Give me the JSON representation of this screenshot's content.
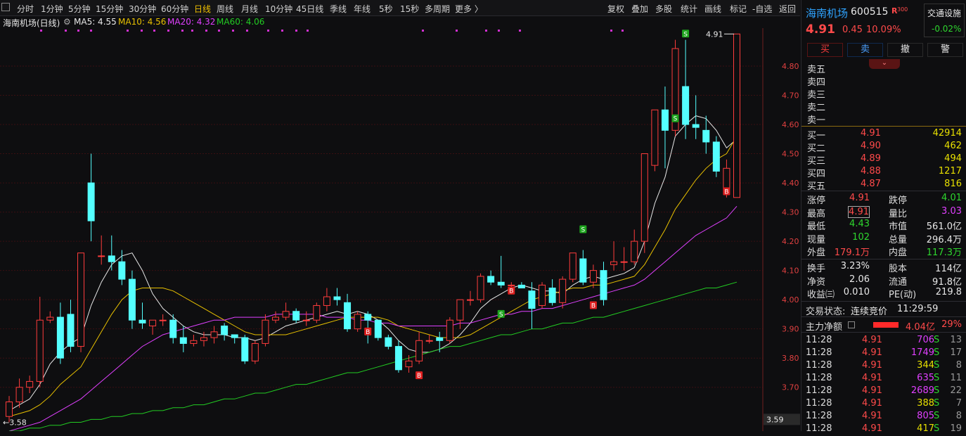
{
  "toolbar": {
    "periods": [
      "分时",
      "1分钟",
      "5分钟",
      "15分钟",
      "30分钟",
      "60分钟",
      "日线",
      "周线",
      "月线",
      "10分钟",
      "45日线",
      "季线",
      "年线",
      "5秒",
      "15秒",
      "多周期",
      "更多 〉"
    ],
    "active_period": "日线",
    "tools": [
      "复权",
      "叠加",
      "多股",
      "统计",
      "画线",
      "标记",
      "-自选",
      "返回"
    ]
  },
  "chart_title": "海南机场(日线)",
  "ma_legend": [
    {
      "label": "MA5: 4.55",
      "color": "#e8e8e8"
    },
    {
      "label": "MA10: 4.56",
      "color": "#e8c000"
    },
    {
      "label": "MA20: 4.32",
      "color": "#e040ff"
    },
    {
      "label": "MA60: 4.06",
      "color": "#22cc22"
    }
  ],
  "chart_data": {
    "type": "candlestick",
    "ylim": [
      3.55,
      4.93
    ],
    "yticks": [
      "4.80",
      "4.70",
      "4.60",
      "4.50",
      "4.40",
      "4.30",
      "4.20",
      "4.10",
      "4.00",
      "3.90",
      "3.80",
      "3.70"
    ],
    "ytick_values": [
      4.8,
      4.7,
      4.6,
      4.5,
      4.4,
      4.3,
      4.2,
      4.1,
      4.0,
      3.9,
      3.8,
      3.7
    ],
    "cursor_value": "3.59",
    "high_label": "4.91",
    "low_label": "3.58",
    "candles": [
      [
        3.6,
        3.65,
        3.58,
        3.67
      ],
      [
        3.65,
        3.7,
        3.63,
        3.73
      ],
      [
        3.7,
        3.72,
        3.68,
        3.74
      ],
      [
        3.72,
        3.93,
        3.7,
        4.01
      ],
      [
        3.93,
        3.94,
        3.92,
        3.96
      ],
      [
        3.94,
        3.8,
        3.78,
        3.99
      ],
      [
        3.95,
        3.84,
        3.82,
        4.0
      ],
      [
        3.84,
        4.16,
        3.82,
        4.16
      ],
      [
        4.4,
        4.27,
        4.2,
        4.5
      ],
      [
        4.15,
        4.15,
        4.12,
        4.22
      ],
      [
        4.15,
        4.13,
        4.1,
        4.22
      ],
      [
        4.13,
        4.07,
        4.05,
        4.17
      ],
      [
        4.07,
        3.93,
        3.9,
        4.1
      ],
      [
        3.93,
        3.92,
        3.9,
        3.99
      ],
      [
        3.91,
        3.93,
        3.88,
        3.93
      ],
      [
        3.93,
        3.93,
        3.91,
        3.95
      ],
      [
        3.93,
        3.87,
        3.85,
        3.95
      ],
      [
        3.87,
        3.85,
        3.82,
        3.91
      ],
      [
        3.85,
        3.86,
        3.84,
        3.88
      ],
      [
        3.86,
        3.87,
        3.84,
        3.89
      ],
      [
        3.87,
        3.89,
        3.85,
        3.91
      ],
      [
        3.91,
        3.88,
        3.86,
        3.92
      ],
      [
        3.88,
        3.87,
        3.85,
        3.88
      ],
      [
        3.87,
        3.79,
        3.78,
        3.88
      ],
      [
        3.79,
        3.85,
        3.78,
        3.86
      ],
      [
        3.85,
        3.93,
        3.84,
        3.95
      ],
      [
        3.93,
        3.94,
        3.92,
        3.96
      ],
      [
        3.94,
        3.96,
        3.93,
        3.99
      ],
      [
        3.96,
        3.93,
        3.92,
        3.97
      ],
      [
        3.93,
        3.93,
        3.91,
        3.96
      ],
      [
        3.93,
        3.98,
        3.92,
        3.99
      ],
      [
        3.98,
        4.01,
        3.96,
        4.04
      ],
      [
        4.01,
        4.0,
        3.98,
        4.04
      ],
      [
        3.99,
        3.9,
        3.89,
        4.02
      ],
      [
        3.9,
        3.95,
        3.89,
        3.96
      ],
      [
        3.95,
        3.93,
        3.85,
        3.96
      ],
      [
        3.93,
        3.87,
        3.86,
        3.93
      ],
      [
        3.87,
        3.84,
        3.83,
        3.88
      ],
      [
        3.84,
        3.76,
        3.75,
        3.86
      ],
      [
        3.77,
        3.79,
        3.75,
        3.81
      ],
      [
        3.79,
        3.86,
        3.78,
        3.89
      ],
      [
        3.86,
        3.86,
        3.85,
        3.88
      ],
      [
        3.87,
        3.86,
        3.82,
        3.89
      ],
      [
        3.86,
        3.93,
        3.85,
        3.94
      ],
      [
        3.93,
        4.0,
        3.9,
        4.0
      ],
      [
        4.0,
        4.0,
        3.98,
        4.03
      ],
      [
        4.0,
        4.08,
        3.99,
        4.09
      ],
      [
        4.08,
        4.06,
        4.05,
        4.1
      ],
      [
        4.06,
        4.05,
        4.04,
        4.15
      ],
      [
        4.05,
        4.05,
        4.03,
        4.06
      ],
      [
        4.05,
        4.04,
        4.04,
        4.06
      ],
      [
        4.03,
        3.97,
        3.9,
        4.06
      ],
      [
        3.98,
        4.05,
        3.97,
        4.06
      ],
      [
        4.04,
        3.99,
        3.98,
        4.07
      ],
      [
        3.99,
        4.07,
        3.97,
        4.08
      ],
      [
        4.07,
        4.16,
        4.06,
        4.16
      ],
      [
        4.14,
        4.06,
        4.05,
        4.17
      ],
      [
        4.06,
        4.1,
        4.04,
        4.12
      ],
      [
        4.1,
        4.0,
        3.98,
        4.13
      ],
      [
        4.12,
        4.13,
        4.1,
        4.2
      ],
      [
        4.13,
        4.13,
        4.1,
        4.18
      ],
      [
        4.13,
        4.2,
        4.12,
        4.24
      ],
      [
        4.2,
        4.5,
        4.16,
        4.5
      ],
      [
        4.46,
        4.65,
        4.44,
        4.64
      ],
      [
        4.65,
        4.58,
        4.45,
        4.73
      ],
      [
        4.58,
        4.86,
        4.56,
        4.89
      ],
      [
        4.73,
        4.6,
        4.55,
        4.89
      ],
      [
        4.6,
        4.59,
        4.55,
        4.7
      ],
      [
        4.58,
        4.54,
        4.5,
        4.63
      ],
      [
        4.54,
        4.44,
        4.42,
        4.56
      ],
      [
        4.38,
        4.45,
        4.35,
        4.48
      ],
      [
        4.35,
        4.91,
        4.43,
        4.91
      ]
    ],
    "markers": [
      {
        "label": "S",
        "index": 56,
        "value": 4.24,
        "color": "#1ea51e"
      },
      {
        "label": "B",
        "index": 35,
        "value": 3.89,
        "color": "#e02020"
      },
      {
        "label": "S",
        "index": 48,
        "value": 3.95,
        "color": "#1ea51e"
      },
      {
        "label": "B",
        "index": 40,
        "value": 3.74,
        "color": "#e02020"
      },
      {
        "label": "B",
        "index": 49,
        "value": 4.03,
        "color": "#e02020"
      },
      {
        "label": "B",
        "index": 57,
        "value": 3.98,
        "color": "#e02020"
      },
      {
        "label": "S",
        "index": 65,
        "value": 4.62,
        "color": "#1ea51e"
      },
      {
        "label": "S",
        "index": 66,
        "value": 4.91,
        "color": "#1ea51e"
      },
      {
        "label": "B",
        "index": 70,
        "value": 4.37,
        "color": "#e02020"
      }
    ],
    "series": [
      {
        "name": "MA5",
        "color": "#e8e8e8",
        "values": [
          3.62,
          3.64,
          3.66,
          3.71,
          3.78,
          3.82,
          3.85,
          3.87,
          3.98,
          4.06,
          4.12,
          4.15,
          4.16,
          4.1,
          4.02,
          3.97,
          3.94,
          3.91,
          3.89,
          3.88,
          3.88,
          3.88,
          3.87,
          3.87,
          3.86,
          3.87,
          3.89,
          3.91,
          3.92,
          3.93,
          3.94,
          3.95,
          3.96,
          3.95,
          3.96,
          3.95,
          3.93,
          3.9,
          3.86,
          3.83,
          3.82,
          3.82,
          3.83,
          3.85,
          3.88,
          3.92,
          3.97,
          4.0,
          4.02,
          4.04,
          4.05,
          4.04,
          4.03,
          4.03,
          4.02,
          4.05,
          4.07,
          4.08,
          4.07,
          4.08,
          4.09,
          4.11,
          4.2,
          4.33,
          4.42,
          4.56,
          4.6,
          4.63,
          4.62,
          4.58,
          4.52,
          4.55
        ]
      },
      {
        "name": "MA10",
        "color": "#e8c000",
        "values": [
          3.6,
          3.61,
          3.62,
          3.64,
          3.67,
          3.71,
          3.74,
          3.77,
          3.83,
          3.89,
          3.95,
          4.0,
          4.03,
          4.04,
          4.04,
          4.04,
          4.03,
          4.01,
          3.99,
          3.97,
          3.95,
          3.93,
          3.91,
          3.89,
          3.88,
          3.88,
          3.88,
          3.88,
          3.89,
          3.9,
          3.91,
          3.92,
          3.93,
          3.94,
          3.94,
          3.94,
          3.94,
          3.93,
          3.91,
          3.9,
          3.89,
          3.88,
          3.87,
          3.87,
          3.87,
          3.88,
          3.9,
          3.92,
          3.94,
          3.96,
          3.98,
          4.0,
          4.01,
          4.02,
          4.03,
          4.04,
          4.04,
          4.05,
          4.05,
          4.06,
          4.07,
          4.08,
          4.12,
          4.18,
          4.24,
          4.31,
          4.36,
          4.41,
          4.45,
          4.48,
          4.5,
          4.56
        ]
      },
      {
        "name": "MA20",
        "color": "#e040ff",
        "values": [
          3.55,
          3.56,
          3.57,
          3.58,
          3.6,
          3.62,
          3.64,
          3.66,
          3.69,
          3.72,
          3.75,
          3.78,
          3.81,
          3.84,
          3.86,
          3.88,
          3.89,
          3.9,
          3.91,
          3.92,
          3.93,
          3.93,
          3.94,
          3.94,
          3.94,
          3.94,
          3.95,
          3.95,
          3.95,
          3.95,
          3.95,
          3.94,
          3.94,
          3.94,
          3.93,
          3.93,
          3.92,
          3.92,
          3.91,
          3.91,
          3.91,
          3.91,
          3.91,
          3.91,
          3.92,
          3.92,
          3.93,
          3.94,
          3.95,
          3.95,
          3.96,
          3.96,
          3.97,
          3.97,
          3.98,
          3.99,
          4.0,
          4.01,
          4.02,
          4.03,
          4.04,
          4.05,
          4.07,
          4.1,
          4.13,
          4.16,
          4.19,
          4.22,
          4.24,
          4.26,
          4.28,
          4.32
        ]
      },
      {
        "name": "MA60",
        "color": "#22cc22",
        "values": [
          3.55,
          3.55,
          3.56,
          3.56,
          3.57,
          3.57,
          3.58,
          3.58,
          3.59,
          3.59,
          3.6,
          3.6,
          3.61,
          3.61,
          3.62,
          3.62,
          3.63,
          3.63,
          3.64,
          3.64,
          3.65,
          3.66,
          3.66,
          3.67,
          3.68,
          3.68,
          3.69,
          3.7,
          3.71,
          3.71,
          3.72,
          3.73,
          3.74,
          3.75,
          3.75,
          3.76,
          3.77,
          3.78,
          3.79,
          3.8,
          3.81,
          3.82,
          3.83,
          3.84,
          3.84,
          3.85,
          3.86,
          3.87,
          3.88,
          3.88,
          3.89,
          3.9,
          3.9,
          3.91,
          3.92,
          3.92,
          3.93,
          3.94,
          3.94,
          3.95,
          3.96,
          3.97,
          3.98,
          3.99,
          4.0,
          4.01,
          4.02,
          4.03,
          4.04,
          4.04,
          4.05,
          4.06
        ]
      }
    ]
  },
  "panel": {
    "stock_name": "海南机场",
    "code": "600515",
    "badge": "R",
    "badge_sup": "300",
    "jiaotong": "交通设施",
    "jiaotong_change": "-0.02%",
    "price": "4.91",
    "change": "0.45",
    "pct": "10.09%",
    "buttons": [
      "买",
      "卖",
      "撤",
      "警"
    ],
    "sell_levels": [
      "卖五",
      "卖四",
      "卖三",
      "卖二",
      "卖一"
    ],
    "buy_levels": [
      {
        "label": "买一",
        "price": "4.91",
        "vol": "42914"
      },
      {
        "label": "买二",
        "price": "4.90",
        "vol": "462"
      },
      {
        "label": "买三",
        "price": "4.89",
        "vol": "494"
      },
      {
        "label": "买四",
        "price": "4.88",
        "vol": "1217"
      },
      {
        "label": "买五",
        "price": "4.87",
        "vol": "816"
      }
    ],
    "stats": [
      {
        "l1": "涨停",
        "v1": "4.91",
        "c1": "red",
        "l2": "跌停",
        "v2": "4.01",
        "c2": "green"
      },
      {
        "l1": "最高",
        "v1": "4.91",
        "c1": "red",
        "l2": "量比",
        "v2": "3.03",
        "c2": "purple"
      },
      {
        "l1": "最低",
        "v1": "4.43",
        "c1": "green",
        "l2": "市值",
        "v2": "561.0亿",
        "c2": "white"
      },
      {
        "l1": "现量",
        "v1": "102",
        "c1": "green",
        "l2": "总量",
        "v2": "296.4万",
        "c2": "white"
      },
      {
        "l1": "外盘",
        "v1": "179.1万",
        "c1": "red",
        "l2": "内盘",
        "v2": "117.3万",
        "c2": "green"
      }
    ],
    "stats2": [
      {
        "l1": "换手",
        "v1": "3.23%",
        "l2": "股本",
        "v2": "114亿"
      },
      {
        "l1": "净资",
        "v1": "2.06",
        "l2": "流通",
        "v2": "91.8亿"
      },
      {
        "l1": "收益㈢",
        "v1": "0.010",
        "l2": "PE(动)",
        "v2": "219.8"
      }
    ],
    "trade_status_label": "交易状态:",
    "trade_status": "连续竞价",
    "trade_time": "11:29:59",
    "main_net_label": "主力净额",
    "main_net": "4.04亿",
    "main_pct": "29%",
    "ticks": [
      {
        "t": "11:28",
        "p": "4.91",
        "v": "706",
        "vc": "purple",
        "s": "S",
        "n": "13"
      },
      {
        "t": "11:28",
        "p": "4.91",
        "v": "1749",
        "vc": "purple",
        "s": "S",
        "n": "17"
      },
      {
        "t": "11:28",
        "p": "4.91",
        "v": "344",
        "vc": "yellow",
        "s": "S",
        "n": "8"
      },
      {
        "t": "11:28",
        "p": "4.91",
        "v": "635",
        "vc": "purple",
        "s": "S",
        "n": "11"
      },
      {
        "t": "11:28",
        "p": "4.91",
        "v": "2689",
        "vc": "purple",
        "s": "S",
        "n": "22"
      },
      {
        "t": "11:28",
        "p": "4.91",
        "v": "388",
        "vc": "yellow",
        "s": "S",
        "n": "7"
      },
      {
        "t": "11:28",
        "p": "4.91",
        "v": "805",
        "vc": "purple",
        "s": "S",
        "n": "8"
      },
      {
        "t": "11:28",
        "p": "4.91",
        "v": "417",
        "vc": "yellow",
        "s": "S",
        "n": "19"
      }
    ]
  }
}
